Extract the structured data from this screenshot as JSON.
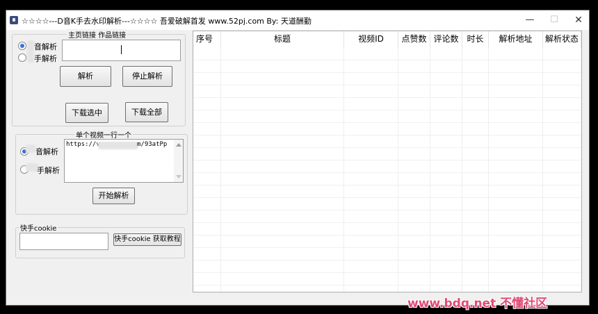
{
  "window": {
    "title": "☆☆☆☆---D音K手去水印解析---☆☆☆☆ 吾爱破解首发  www.52pj.com   By: 天道酬勤",
    "min_glyph": "—",
    "max_glyph": "☐",
    "close_glyph": "✕"
  },
  "homepage_group": {
    "legend": "主页链接 作品链接",
    "radio_douyin": "音解析",
    "radio_kuaishou": "手解析",
    "link_value": "",
    "parse_button": "解析",
    "stop_button": "停止解析",
    "download_selected_button": "下载选中",
    "download_all_button": "下载全部"
  },
  "single_group": {
    "legend": "单个视频一行一个",
    "radio_douyin": "音解析",
    "radio_kuaishou": "手解析",
    "url_text_start": "https://v.",
    "url_text_end": "m/93atPp",
    "start_button": "开始解析"
  },
  "cookie_group": {
    "legend": "快手cookie",
    "cookie_value": "",
    "tutorial_button": "快手cookie 获取教程"
  },
  "table": {
    "columns": [
      "序号",
      "标题",
      "视频ID",
      "点赞数",
      "评论数",
      "时长",
      "解析地址",
      "解析状态"
    ]
  },
  "watermark": {
    "text": "www.bdq.net 不懂社区"
  }
}
